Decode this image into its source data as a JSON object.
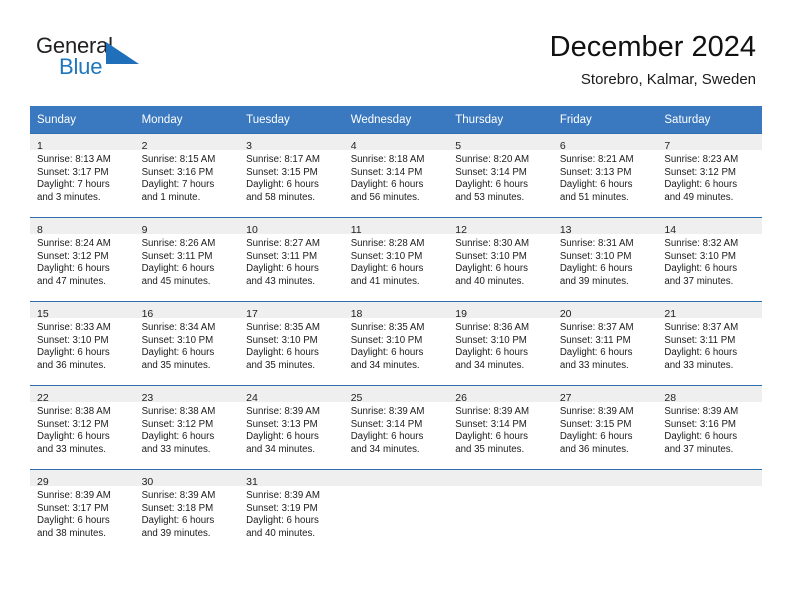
{
  "brand": {
    "name_top": "General",
    "name_bottom": "Blue",
    "accent_color": "#1f77bd",
    "logo_icon": "triangle-logo-icon"
  },
  "header": {
    "title": "December 2024",
    "subtitle": "Storebro, Kalmar, Sweden"
  },
  "calendar": {
    "header_bg": "#3a78bf",
    "daynum_bg": "#efefef",
    "weekdays": [
      "Sunday",
      "Monday",
      "Tuesday",
      "Wednesday",
      "Thursday",
      "Friday",
      "Saturday"
    ],
    "weeks": [
      [
        {
          "day": "1",
          "sunrise": "Sunrise: 8:13 AM",
          "sunset": "Sunset: 3:17 PM",
          "daylight1": "Daylight: 7 hours",
          "daylight2": "and 3 minutes."
        },
        {
          "day": "2",
          "sunrise": "Sunrise: 8:15 AM",
          "sunset": "Sunset: 3:16 PM",
          "daylight1": "Daylight: 7 hours",
          "daylight2": "and 1 minute."
        },
        {
          "day": "3",
          "sunrise": "Sunrise: 8:17 AM",
          "sunset": "Sunset: 3:15 PM",
          "daylight1": "Daylight: 6 hours",
          "daylight2": "and 58 minutes."
        },
        {
          "day": "4",
          "sunrise": "Sunrise: 8:18 AM",
          "sunset": "Sunset: 3:14 PM",
          "daylight1": "Daylight: 6 hours",
          "daylight2": "and 56 minutes."
        },
        {
          "day": "5",
          "sunrise": "Sunrise: 8:20 AM",
          "sunset": "Sunset: 3:14 PM",
          "daylight1": "Daylight: 6 hours",
          "daylight2": "and 53 minutes."
        },
        {
          "day": "6",
          "sunrise": "Sunrise: 8:21 AM",
          "sunset": "Sunset: 3:13 PM",
          "daylight1": "Daylight: 6 hours",
          "daylight2": "and 51 minutes."
        },
        {
          "day": "7",
          "sunrise": "Sunrise: 8:23 AM",
          "sunset": "Sunset: 3:12 PM",
          "daylight1": "Daylight: 6 hours",
          "daylight2": "and 49 minutes."
        }
      ],
      [
        {
          "day": "8",
          "sunrise": "Sunrise: 8:24 AM",
          "sunset": "Sunset: 3:12 PM",
          "daylight1": "Daylight: 6 hours",
          "daylight2": "and 47 minutes."
        },
        {
          "day": "9",
          "sunrise": "Sunrise: 8:26 AM",
          "sunset": "Sunset: 3:11 PM",
          "daylight1": "Daylight: 6 hours",
          "daylight2": "and 45 minutes."
        },
        {
          "day": "10",
          "sunrise": "Sunrise: 8:27 AM",
          "sunset": "Sunset: 3:11 PM",
          "daylight1": "Daylight: 6 hours",
          "daylight2": "and 43 minutes."
        },
        {
          "day": "11",
          "sunrise": "Sunrise: 8:28 AM",
          "sunset": "Sunset: 3:10 PM",
          "daylight1": "Daylight: 6 hours",
          "daylight2": "and 41 minutes."
        },
        {
          "day": "12",
          "sunrise": "Sunrise: 8:30 AM",
          "sunset": "Sunset: 3:10 PM",
          "daylight1": "Daylight: 6 hours",
          "daylight2": "and 40 minutes."
        },
        {
          "day": "13",
          "sunrise": "Sunrise: 8:31 AM",
          "sunset": "Sunset: 3:10 PM",
          "daylight1": "Daylight: 6 hours",
          "daylight2": "and 39 minutes."
        },
        {
          "day": "14",
          "sunrise": "Sunrise: 8:32 AM",
          "sunset": "Sunset: 3:10 PM",
          "daylight1": "Daylight: 6 hours",
          "daylight2": "and 37 minutes."
        }
      ],
      [
        {
          "day": "15",
          "sunrise": "Sunrise: 8:33 AM",
          "sunset": "Sunset: 3:10 PM",
          "daylight1": "Daylight: 6 hours",
          "daylight2": "and 36 minutes."
        },
        {
          "day": "16",
          "sunrise": "Sunrise: 8:34 AM",
          "sunset": "Sunset: 3:10 PM",
          "daylight1": "Daylight: 6 hours",
          "daylight2": "and 35 minutes."
        },
        {
          "day": "17",
          "sunrise": "Sunrise: 8:35 AM",
          "sunset": "Sunset: 3:10 PM",
          "daylight1": "Daylight: 6 hours",
          "daylight2": "and 35 minutes."
        },
        {
          "day": "18",
          "sunrise": "Sunrise: 8:35 AM",
          "sunset": "Sunset: 3:10 PM",
          "daylight1": "Daylight: 6 hours",
          "daylight2": "and 34 minutes."
        },
        {
          "day": "19",
          "sunrise": "Sunrise: 8:36 AM",
          "sunset": "Sunset: 3:10 PM",
          "daylight1": "Daylight: 6 hours",
          "daylight2": "and 34 minutes."
        },
        {
          "day": "20",
          "sunrise": "Sunrise: 8:37 AM",
          "sunset": "Sunset: 3:11 PM",
          "daylight1": "Daylight: 6 hours",
          "daylight2": "and 33 minutes."
        },
        {
          "day": "21",
          "sunrise": "Sunrise: 8:37 AM",
          "sunset": "Sunset: 3:11 PM",
          "daylight1": "Daylight: 6 hours",
          "daylight2": "and 33 minutes."
        }
      ],
      [
        {
          "day": "22",
          "sunrise": "Sunrise: 8:38 AM",
          "sunset": "Sunset: 3:12 PM",
          "daylight1": "Daylight: 6 hours",
          "daylight2": "and 33 minutes."
        },
        {
          "day": "23",
          "sunrise": "Sunrise: 8:38 AM",
          "sunset": "Sunset: 3:12 PM",
          "daylight1": "Daylight: 6 hours",
          "daylight2": "and 33 minutes."
        },
        {
          "day": "24",
          "sunrise": "Sunrise: 8:39 AM",
          "sunset": "Sunset: 3:13 PM",
          "daylight1": "Daylight: 6 hours",
          "daylight2": "and 34 minutes."
        },
        {
          "day": "25",
          "sunrise": "Sunrise: 8:39 AM",
          "sunset": "Sunset: 3:14 PM",
          "daylight1": "Daylight: 6 hours",
          "daylight2": "and 34 minutes."
        },
        {
          "day": "26",
          "sunrise": "Sunrise: 8:39 AM",
          "sunset": "Sunset: 3:14 PM",
          "daylight1": "Daylight: 6 hours",
          "daylight2": "and 35 minutes."
        },
        {
          "day": "27",
          "sunrise": "Sunrise: 8:39 AM",
          "sunset": "Sunset: 3:15 PM",
          "daylight1": "Daylight: 6 hours",
          "daylight2": "and 36 minutes."
        },
        {
          "day": "28",
          "sunrise": "Sunrise: 8:39 AM",
          "sunset": "Sunset: 3:16 PM",
          "daylight1": "Daylight: 6 hours",
          "daylight2": "and 37 minutes."
        }
      ],
      [
        {
          "day": "29",
          "sunrise": "Sunrise: 8:39 AM",
          "sunset": "Sunset: 3:17 PM",
          "daylight1": "Daylight: 6 hours",
          "daylight2": "and 38 minutes."
        },
        {
          "day": "30",
          "sunrise": "Sunrise: 8:39 AM",
          "sunset": "Sunset: 3:18 PM",
          "daylight1": "Daylight: 6 hours",
          "daylight2": "and 39 minutes."
        },
        {
          "day": "31",
          "sunrise": "Sunrise: 8:39 AM",
          "sunset": "Sunset: 3:19 PM",
          "daylight1": "Daylight: 6 hours",
          "daylight2": "and 40 minutes."
        },
        {
          "day": "",
          "sunrise": "",
          "sunset": "",
          "daylight1": "",
          "daylight2": ""
        },
        {
          "day": "",
          "sunrise": "",
          "sunset": "",
          "daylight1": "",
          "daylight2": ""
        },
        {
          "day": "",
          "sunrise": "",
          "sunset": "",
          "daylight1": "",
          "daylight2": ""
        },
        {
          "day": "",
          "sunrise": "",
          "sunset": "",
          "daylight1": "",
          "daylight2": ""
        }
      ]
    ]
  }
}
